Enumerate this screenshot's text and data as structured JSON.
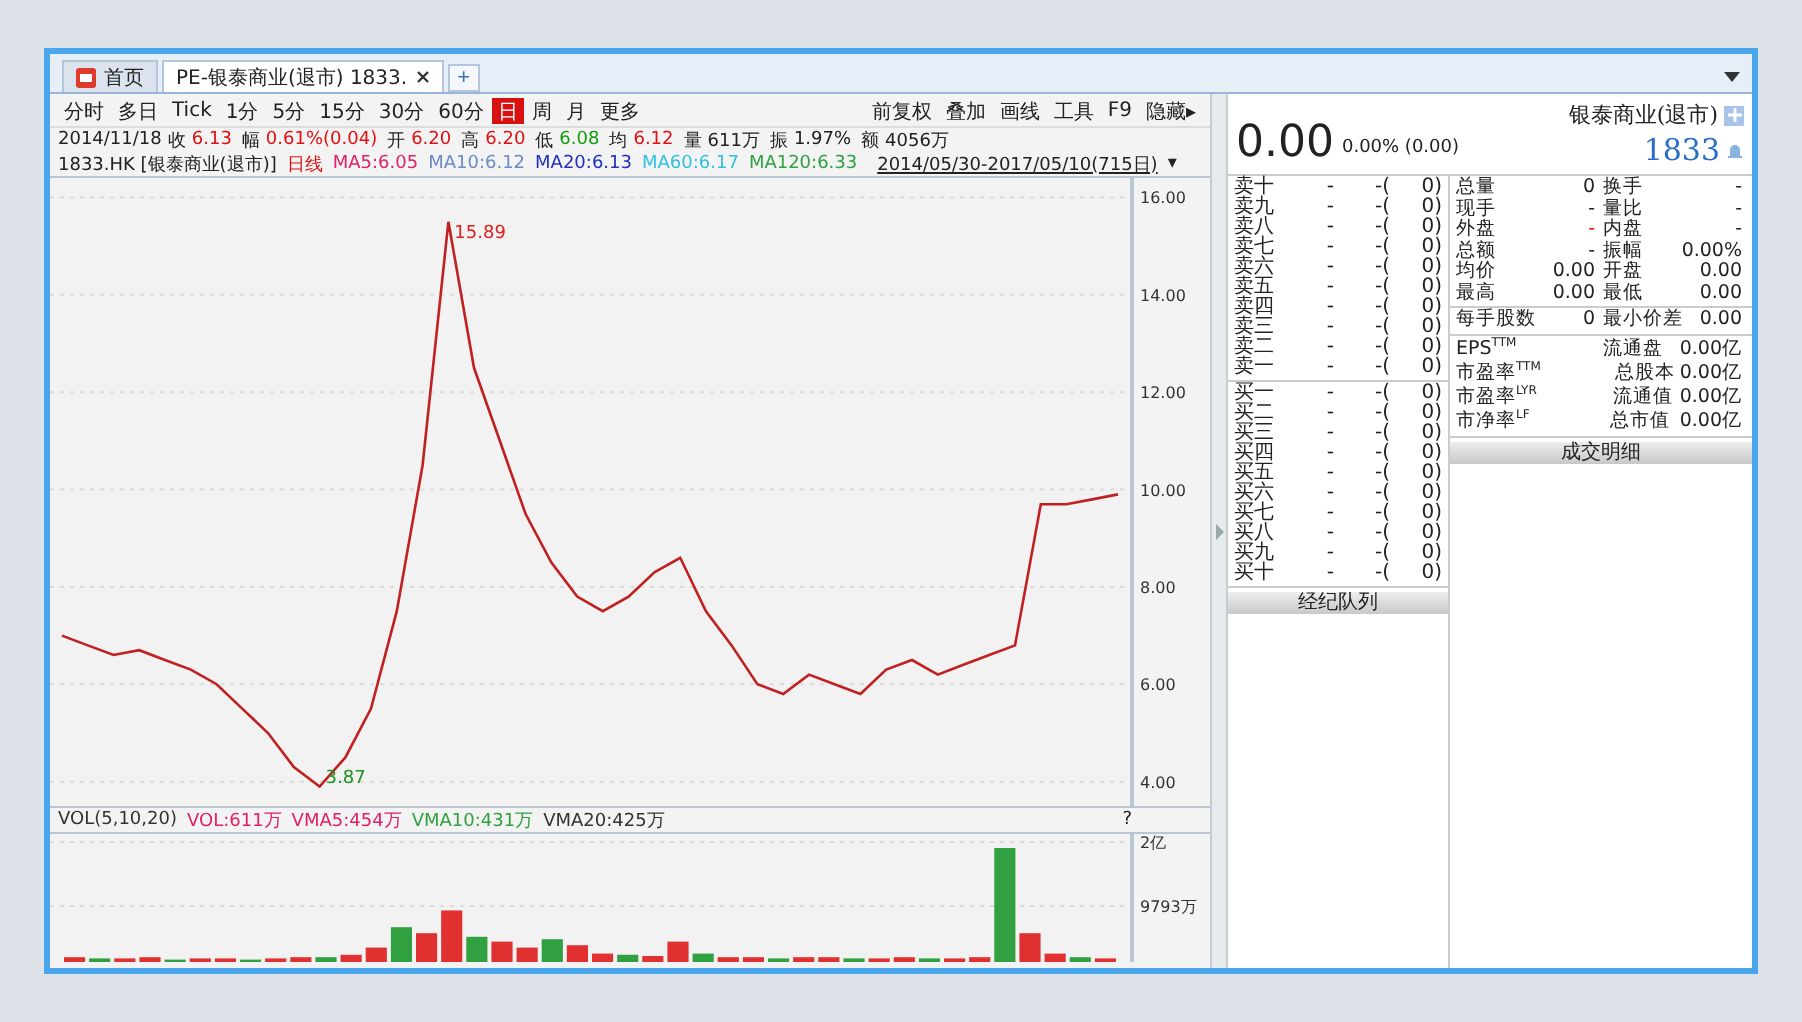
{
  "tabs": [
    {
      "label": "首页",
      "kind": "home",
      "selected": false,
      "closable": false
    },
    {
      "label": "PE-银泰商业(退市) 1833.",
      "kind": "stock",
      "selected": true,
      "closable": true
    }
  ],
  "new_tab": "+",
  "periods": [
    {
      "label": "分时",
      "selected": false
    },
    {
      "label": "多日",
      "selected": false
    },
    {
      "label": "Tick",
      "selected": false
    },
    {
      "label": "1分",
      "selected": false
    },
    {
      "label": "5分",
      "selected": false
    },
    {
      "label": "15分",
      "selected": false
    },
    {
      "label": "30分",
      "selected": false
    },
    {
      "label": "60分",
      "selected": false
    },
    {
      "label": "日",
      "selected": true
    },
    {
      "label": "周",
      "selected": false
    },
    {
      "label": "月",
      "selected": false
    },
    {
      "label": "更多",
      "selected": false
    }
  ],
  "tools": [
    "前复权",
    "叠加",
    "画线",
    "工具",
    "F9",
    "隐藏▸"
  ],
  "quote_line": [
    {
      "label": "2014/11/18"
    },
    {
      "label": "收",
      "value": "6.13",
      "color": "#e01010"
    },
    {
      "label": "幅",
      "value": "0.61%(0.04)",
      "color": "#e01010"
    },
    {
      "label": "开",
      "value": "6.20",
      "color": "#e01010"
    },
    {
      "label": "高",
      "value": "6.20",
      "color": "#e01010"
    },
    {
      "label": "低",
      "value": "6.08",
      "color": "#10a010"
    },
    {
      "label": "均",
      "value": "6.12",
      "color": "#e01010"
    },
    {
      "label": "量",
      "value": "611万"
    },
    {
      "label": "振",
      "value": "1.97%"
    },
    {
      "label": "额",
      "value": "4056万"
    }
  ],
  "price_legend": {
    "symbol": "1833.HK [银泰商业(退市)]",
    "period": "日线",
    "mas": [
      {
        "text": "MA5:6.05",
        "color": "#e0206a"
      },
      {
        "text": "MA10:6.12",
        "color": "#6a8ac8"
      },
      {
        "text": "MA20:6.13",
        "color": "#2030c0"
      },
      {
        "text": "MA60:6.17",
        "color": "#30c0e0"
      },
      {
        "text": "MA120:6.33",
        "color": "#30a040"
      }
    ],
    "range": "2014/05/30-2017/05/10(715日)",
    "range_caret": "▾"
  },
  "price_chart": {
    "chart_data": {
      "type": "line",
      "grid": true,
      "series": [
        {
          "color": "#c02020",
          "values": [
            7.0,
            6.8,
            6.6,
            6.7,
            6.5,
            6.3,
            6.0,
            5.5,
            5.0,
            4.3,
            3.9,
            4.5,
            5.5,
            7.5,
            10.5,
            15.5,
            12.5,
            11.0,
            9.5,
            8.5,
            7.8,
            7.5,
            7.8,
            8.3,
            8.6,
            7.5,
            6.8,
            6.0,
            5.8,
            6.2,
            6.0,
            5.8,
            6.3,
            6.5,
            6.2,
            6.4,
            6.6,
            6.8,
            9.7,
            9.7,
            9.8,
            9.9
          ]
        }
      ],
      "ylim": [
        3.5,
        16.4
      ],
      "yticks": [
        {
          "value": 16,
          "label": "16.00"
        },
        {
          "value": 14,
          "label": "14.00"
        },
        {
          "value": 12,
          "label": "12.00"
        },
        {
          "value": 10,
          "label": "10.00"
        },
        {
          "value": 8,
          "label": "8.00"
        },
        {
          "value": 6,
          "label": "6.00"
        },
        {
          "value": 4,
          "label": "4.00"
        }
      ],
      "annotations": [
        "15.89",
        "3.87"
      ]
    }
  },
  "volume_legend": [
    {
      "text": "VOL(5,10,20)",
      "color": "#333333"
    },
    {
      "text": "VOL:611万",
      "color": "#e0206a"
    },
    {
      "text": "VMA5:454万",
      "color": "#e0206a"
    },
    {
      "text": "VMA10:431万",
      "color": "#30a040"
    },
    {
      "text": "VMA20:425万",
      "color": "#333333"
    }
  ],
  "volume_help": "?",
  "volume_chart": {
    "axis_labels": [
      "2亿",
      "9793万"
    ]
  },
  "quote": {
    "price": "0.00",
    "change": "0.00% (0.00)",
    "name": "银泰商业(退市)",
    "code": "1833"
  },
  "asks": [
    {
      "label": "卖十",
      "price": "-",
      "volume": "-(",
      "count": "0)"
    },
    {
      "label": "卖九",
      "price": "-",
      "volume": "-(",
      "count": "0)"
    },
    {
      "label": "卖八",
      "price": "-",
      "volume": "-(",
      "count": "0)"
    },
    {
      "label": "卖七",
      "price": "-",
      "volume": "-(",
      "count": "0)"
    },
    {
      "label": "卖六",
      "price": "-",
      "volume": "-(",
      "count": "0)"
    },
    {
      "label": "卖五",
      "price": "-",
      "volume": "-(",
      "count": "0)"
    },
    {
      "label": "卖四",
      "price": "-",
      "volume": "-(",
      "count": "0)"
    },
    {
      "label": "卖三",
      "price": "-",
      "volume": "-(",
      "count": "0)"
    },
    {
      "label": "卖二",
      "price": "-",
      "volume": "-(",
      "count": "0)"
    },
    {
      "label": "卖一",
      "price": "-",
      "volume": "-(",
      "count": "0)"
    }
  ],
  "bids": [
    {
      "label": "买一",
      "price": "-",
      "volume": "-(",
      "count": "0)"
    },
    {
      "label": "买二",
      "price": "-",
      "volume": "-(",
      "count": "0)"
    },
    {
      "label": "买三",
      "price": "-",
      "volume": "-(",
      "count": "0)"
    },
    {
      "label": "买四",
      "price": "-",
      "volume": "-(",
      "count": "0)"
    },
    {
      "label": "买五",
      "price": "-",
      "volume": "-(",
      "count": "0)"
    },
    {
      "label": "买六",
      "price": "-",
      "volume": "-(",
      "count": "0)"
    },
    {
      "label": "买七",
      "price": "-",
      "volume": "-(",
      "count": "0)"
    },
    {
      "label": "买八",
      "price": "-",
      "volume": "-(",
      "count": "0)"
    },
    {
      "label": "买九",
      "price": "-",
      "volume": "-(",
      "count": "0)"
    },
    {
      "label": "买十",
      "price": "-",
      "volume": "-(",
      "count": "0)"
    }
  ],
  "broker_queue": "经纪队列",
  "stats": [
    [
      {
        "label": "总量",
        "value": "0"
      },
      {
        "label": "换手",
        "value": "-"
      }
    ],
    [
      {
        "label": "现手",
        "value": "-"
      },
      {
        "label": "量比",
        "value": "-"
      }
    ],
    [
      {
        "label": "外盘",
        "value": "-",
        "color": "#e01010"
      },
      {
        "label": "内盘",
        "value": "-"
      }
    ],
    [
      {
        "label": "总额",
        "value": "-"
      },
      {
        "label": "振幅",
        "value": "0.00%"
      }
    ],
    [
      {
        "label": "均价",
        "value": "0.00"
      },
      {
        "label": "开盘",
        "value": "0.00"
      }
    ],
    [
      {
        "label": "最高",
        "value": "0.00"
      },
      {
        "label": "最低",
        "value": "0.00"
      }
    ]
  ],
  "lot_stats": [
    [
      {
        "label": "每手股数",
        "value": "0"
      },
      {
        "label": "最小价差",
        "value": "0.00"
      }
    ]
  ],
  "fundamentals": [
    [
      {
        "label": "EPS$^{TTM}$"
      },
      {
        "label": "流通盘",
        "value": "0.00亿"
      }
    ],
    [
      {
        "label": "市盈率$^{TTM}$"
      },
      {
        "label": "总股本",
        "value": "0.00亿"
      }
    ],
    [
      {
        "label": "市盈率$^{LYR}$"
      },
      {
        "label": "流通值",
        "value": "0.00亿"
      }
    ],
    [
      {
        "label": "市净率$^{LF}$"
      },
      {
        "label": "总市值",
        "value": "0.00亿"
      }
    ]
  ],
  "trade_detail": "成交明细"
}
